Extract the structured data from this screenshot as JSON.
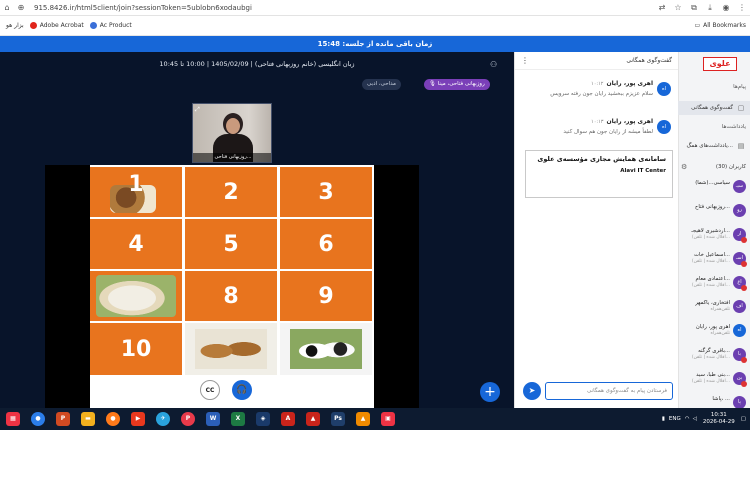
{
  "browser": {
    "url": "915.8426.ir/html5client/join?sessionToken=5ublobn6xodaubgi",
    "bookmarks": [
      "Adobe Acrobat",
      "Ac Product"
    ],
    "bookmark_left": "بزار هو",
    "all_bookmarks": "All Bookmarks"
  },
  "banner": {
    "text": "زمان باقی مانده از جلسه: 15:48"
  },
  "stage": {
    "title": "زبان انگلیسی (خانم روزبهانی فتاحی) | 1405/02/09 | 10:00 تا 10:45",
    "presenter_chip": "روزبهانی فتاحی، مینا",
    "other_chip": "مداحی، ادبی",
    "webcam_name": "روزبهانی فتاحی..."
  },
  "board": {
    "tiles": [
      {
        "label": "1",
        "type": "cow"
      },
      {
        "label": "2",
        "type": "number"
      },
      {
        "label": "3",
        "type": "number"
      },
      {
        "label": "4",
        "type": "number"
      },
      {
        "label": "5",
        "type": "number"
      },
      {
        "label": "6",
        "type": "number"
      },
      {
        "label": "",
        "type": "sheep"
      },
      {
        "label": "8",
        "type": "number"
      },
      {
        "label": "9",
        "type": "number"
      },
      {
        "label": "10",
        "type": "number"
      },
      {
        "label": "",
        "type": "horses"
      },
      {
        "label": "",
        "type": "cows"
      }
    ]
  },
  "chat": {
    "title": "گفت‌وگوی همگانی",
    "messages": [
      {
        "avatar": "اه",
        "name": "اهری پور، رایان",
        "time": "۱۰:۱۲",
        "text": "سلام عزیزم ببخشید رایان جون رفته سرویس"
      },
      {
        "avatar": "اه",
        "name": "اهری پور، رایان",
        "time": "۱۰:۱۳",
        "text": "لطفاً میشه از رایان جون هم سوال کنید"
      }
    ],
    "card_title": "سامانه‌ی همایش مجازی مؤسسه‌ی علوی",
    "card_sub": "Alavi IT Center",
    "input_placeholder": "فرستادن پیام به گفت‌وگوی همگانی"
  },
  "side": {
    "logo": "علوی",
    "messages_label": "پیام‌ها",
    "public_chat": "گفت‌وگوی همگانی",
    "notes_label": "یادداشت‌ها",
    "shared_notes": "یادداشت‌های همگ...",
    "users_label": "کاربران (30)",
    "users": [
      {
        "av": "سیـ",
        "name": "سیاسی...(شما)",
        "sub": "",
        "color": "#6b3fb0",
        "mic": false
      },
      {
        "av": "رو",
        "name": "روزبهانی فتاح...",
        "sub": "",
        "color": "#6b3fb0",
        "mic": false
      },
      {
        "av": "ار",
        "name": "اردشیری لاهیجـ...",
        "sub": "(اقلال شده | تلفن...",
        "color": "#6b3fb0",
        "mic": true
      },
      {
        "av": "اسـ",
        "name": "اسماعیل خات...",
        "sub": "(اقلال شده | تلفن...",
        "color": "#6b3fb0",
        "mic": true
      },
      {
        "av": "اع",
        "name": "اعتمادی معام...",
        "sub": "(اقلال شده | تلفن...",
        "color": "#6b3fb0",
        "mic": true
      },
      {
        "av": "اف",
        "name": "افتخاری، یاکمهر",
        "sub": "تلفن‌همراه",
        "color": "#6b3fb0",
        "mic": false
      },
      {
        "av": "اه",
        "name": "اهری پور، رایان",
        "sub": "تلفن‌همراه",
        "color": "#1767d8",
        "mic": false
      },
      {
        "av": "با",
        "name": "باقری گرگنه...",
        "sub": "(اقلال شده | تلفن...",
        "color": "#6b3fb0",
        "mic": true
      },
      {
        "av": "بن",
        "name": "بنی طبا، سید...",
        "sub": "(اقلال شده | تلفن...",
        "color": "#6b3fb0",
        "mic": true
      },
      {
        "av": "پا",
        "name": "پاشا، ...",
        "sub": "",
        "color": "#6b3fb0",
        "mic": false
      }
    ]
  },
  "taskbar": {
    "time": "10:31",
    "date": "2026-04-29",
    "lang": "ENG"
  }
}
